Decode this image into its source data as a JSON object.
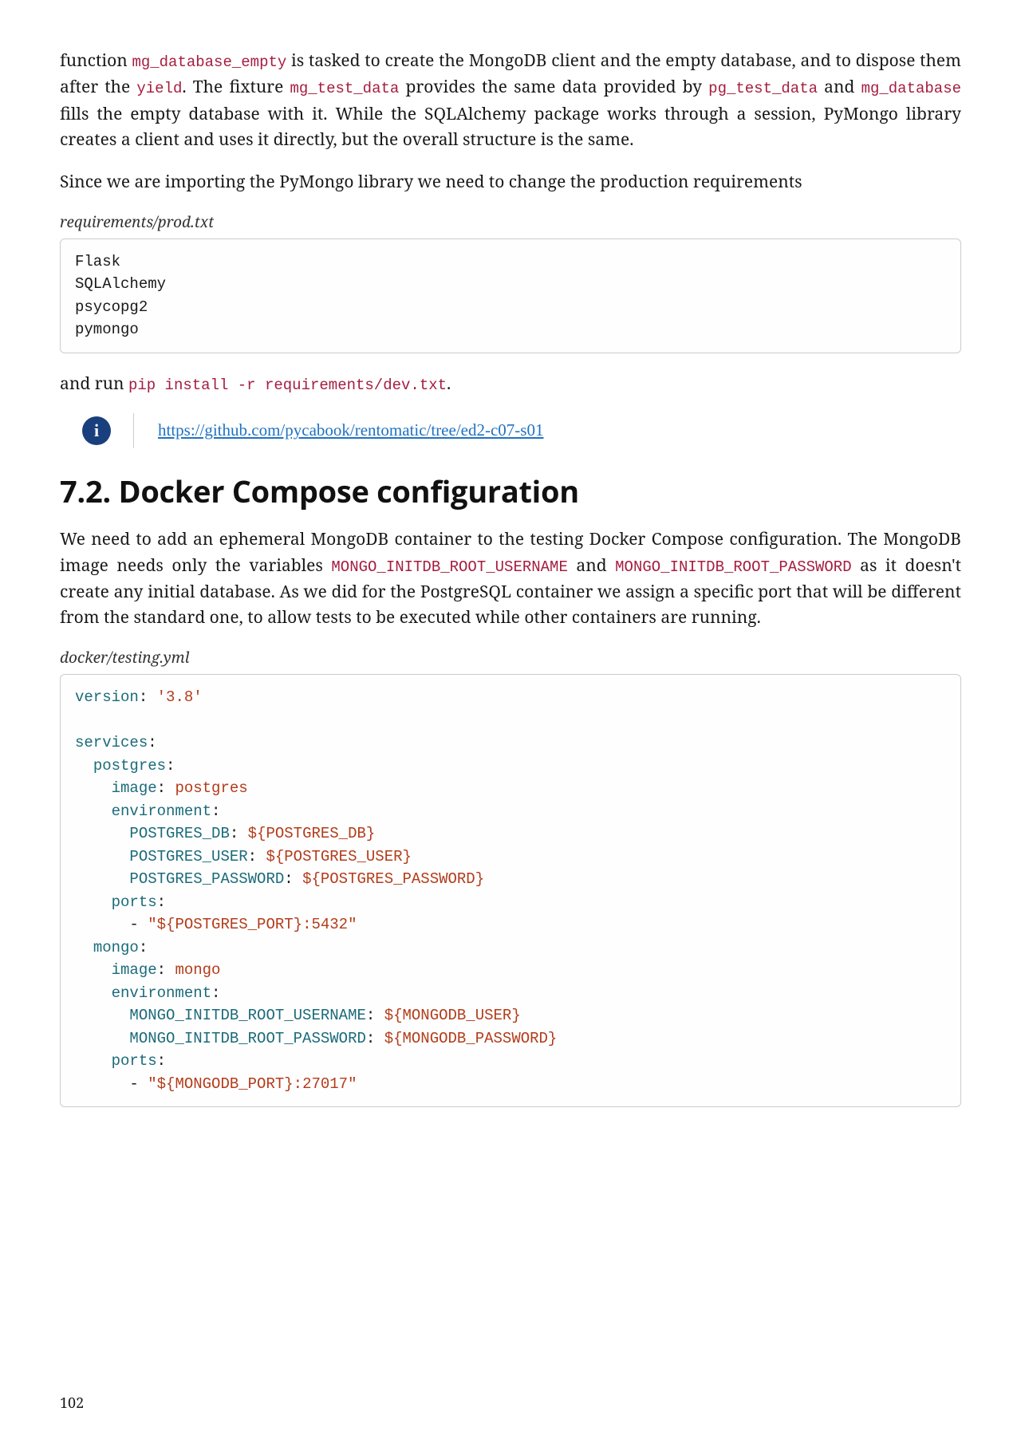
{
  "para1": {
    "seg1": "function ",
    "code1": "mg_database_empty",
    "seg2": " is tasked to create the MongoDB client and the empty database, and to dispose them after the ",
    "code2": "yield",
    "seg3": ". The fixture ",
    "code3": "mg_test_data",
    "seg4": " provides the same data provided by ",
    "code4": "pg_test_data",
    "seg5": " and ",
    "code5": "mg_database",
    "seg6": " fills the empty database with it. While the SQLAlchemy package works through a session, PyMongo library creates a client and uses it directly, but the overall structure is the same."
  },
  "para2": "Since we are importing the PyMongo library we need to change the production requirements",
  "file1_caption": "requirements/prod.txt",
  "file1_code": "Flask\nSQLAlchemy\npsycopg2\npymongo",
  "para3": {
    "seg1": "and run ",
    "code1": "pip install -r requirements/dev.txt",
    "seg2": "."
  },
  "info_icon_glyph": "i",
  "info_link_text": "https://github.com/pycabook/rentomatic/tree/ed2-c07-s01",
  "section_heading": "7.2. Docker Compose configuration",
  "para4": {
    "seg1": "We need to add an ephemeral MongoDB container to the testing Docker Compose configuration. The MongoDB image needs only the variables ",
    "code1": "MONGO_INITDB_ROOT_USERNAME",
    "seg2": " and ",
    "code2": "MONGO_INITDB_ROOT_PASSWORD",
    "seg3": " as it doesn't create any initial database. As we did for the PostgreSQL container we assign a specific port that will be different from the standard one, to allow tests to be executed while other containers are running."
  },
  "file2_caption": "docker/testing.yml",
  "yaml": {
    "l1_k": "version",
    "l1_v": "'3.8'",
    "l3_k": "services",
    "l4_k": "postgres",
    "l5_k": "image",
    "l5_v": "postgres",
    "l6_k": "environment",
    "l7_k": "POSTGRES_DB",
    "l7_v": "${POSTGRES_DB}",
    "l8_k": "POSTGRES_USER",
    "l8_v": "${POSTGRES_USER}",
    "l9_k": "POSTGRES_PASSWORD",
    "l9_v": "${POSTGRES_PASSWORD}",
    "l10_k": "ports",
    "l11_v": "\"${POSTGRES_PORT}:5432\"",
    "l12_k": "mongo",
    "l13_k": "image",
    "l13_v": "mongo",
    "l14_k": "environment",
    "l15_k": "MONGO_INITDB_ROOT_USERNAME",
    "l15_v": "${MONGODB_USER}",
    "l16_k": "MONGO_INITDB_ROOT_PASSWORD",
    "l16_v": "${MONGODB_PASSWORD}",
    "l17_k": "ports",
    "l18_v": "\"${MONGODB_PORT}:27017\""
  },
  "page_number": "102"
}
